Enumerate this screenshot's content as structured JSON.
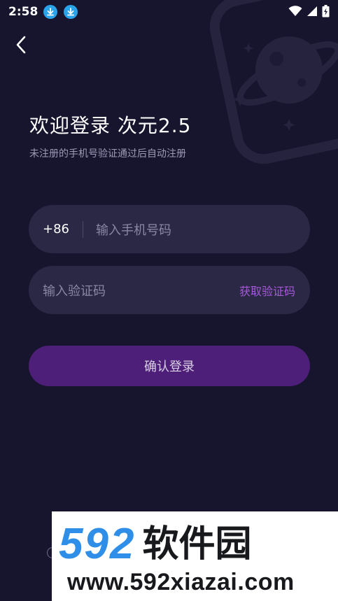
{
  "status_bar": {
    "time": "2:58"
  },
  "header": {
    "title": "欢迎登录 次元2.5",
    "subtitle": "未注册的手机号验证通过后自动注册"
  },
  "phone_field": {
    "country_code": "+86",
    "placeholder": "输入手机号码"
  },
  "code_field": {
    "placeholder": "输入验证码",
    "get_code_label": "获取验证码"
  },
  "login_button": {
    "label": "确认登录"
  },
  "watermark": {
    "number": "592",
    "name": "软件园",
    "url": "www.592xiazai.com"
  },
  "colors": {
    "background": "#17142e",
    "field": "#2a2845",
    "accent": "#a55ad6",
    "button": "#4e1f78"
  },
  "icons": [
    "download-icon",
    "wifi-icon",
    "signal-icon",
    "battery-icon",
    "back-arrow-icon",
    "planet-icon"
  ]
}
